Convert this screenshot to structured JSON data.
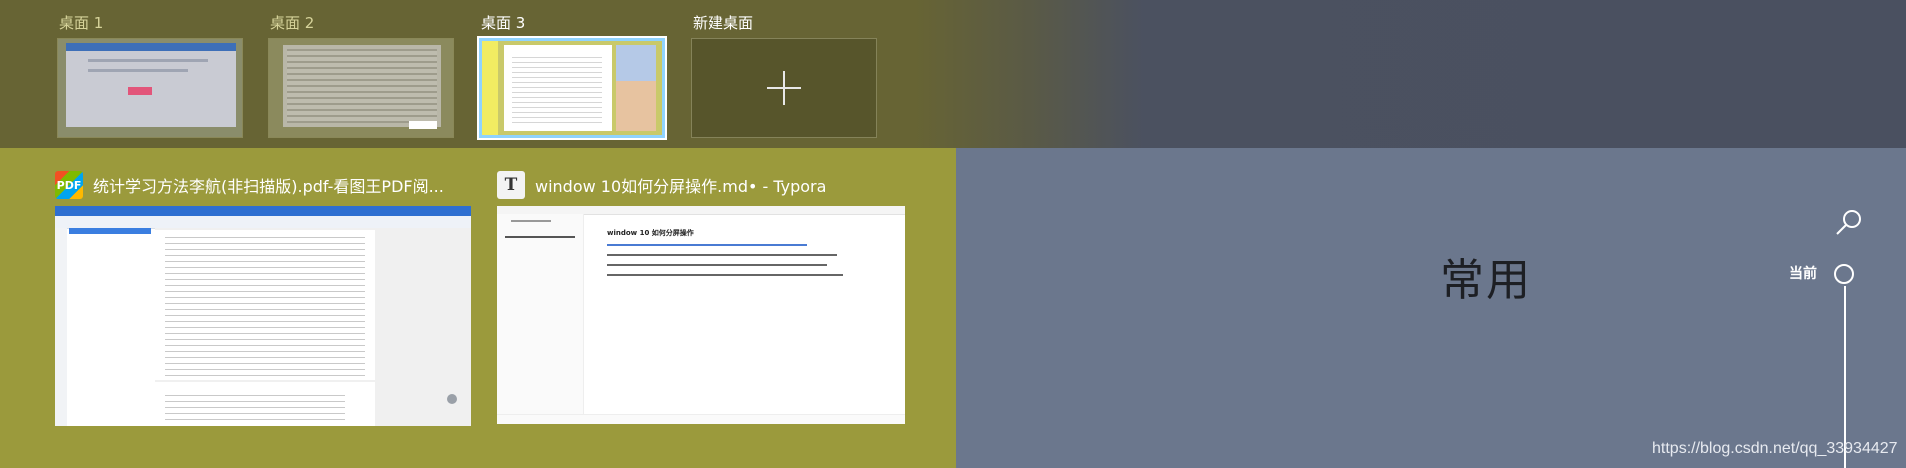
{
  "desktops": [
    {
      "label": "桌面 1"
    },
    {
      "label": "桌面 2"
    },
    {
      "label": "桌面 3",
      "active": true
    }
  ],
  "new_desktop": {
    "label": "新建桌面"
  },
  "windows": [
    {
      "app_icon": "PDF",
      "title": "统计学习方法李航(非扫描版).pdf-看图王PDF阅..."
    },
    {
      "app_icon": "T",
      "title": "window 10如何分屏操作.md• - Typora",
      "doc_heading": "window 10 如何分屏操作"
    }
  ],
  "timeline": {
    "group_label": "常用",
    "current_label": "当前",
    "search_icon": "search-icon"
  },
  "watermark": "https://blog.csdn.net/qq_33934427",
  "colors": {
    "top_band": "#676434",
    "left_area": "#9b9a3c",
    "right_area": "#6b778d",
    "active_border": "#8fd3ff"
  }
}
